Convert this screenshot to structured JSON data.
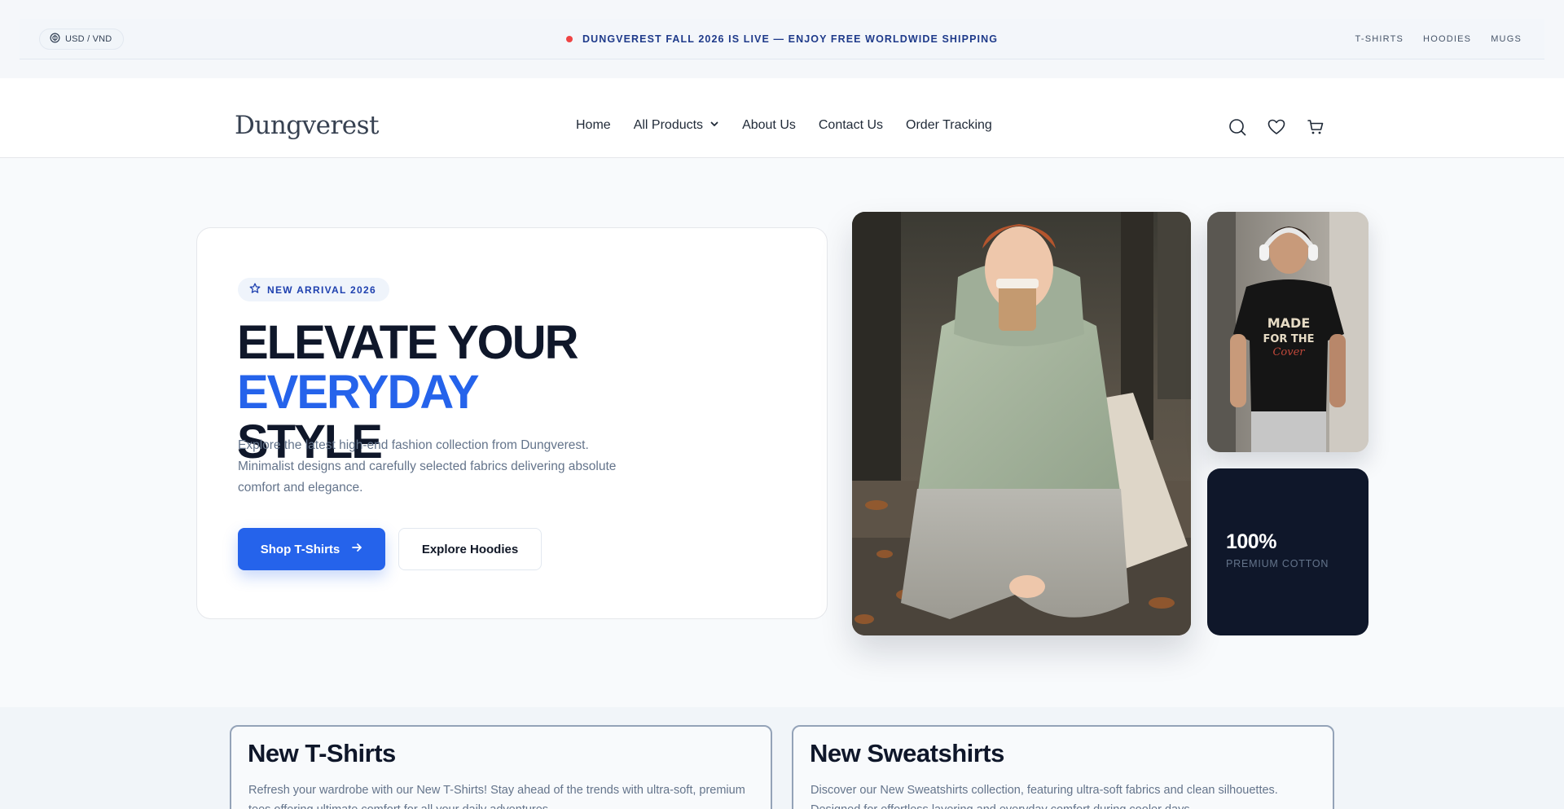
{
  "topbar": {
    "currency": "USD / VND",
    "announcement": "DUNGVEREST FALL 2026 IS LIVE — ENJOY FREE WORLDWIDE SHIPPING",
    "links": [
      "T-SHIRTS",
      "HOODIES",
      "MUGS"
    ]
  },
  "header": {
    "logo": "Dungverest",
    "nav": [
      "Home",
      "All Products",
      "About Us",
      "Contact Us",
      "Order Tracking"
    ],
    "icons": [
      "search-icon",
      "heart-icon",
      "cart-icon"
    ]
  },
  "hero": {
    "badge": "NEW ARRIVAL 2026",
    "title_line1": "ELEVATE YOUR ",
    "title_accent": "EVERYDAY",
    "title_line2": "STYLE",
    "description": "Explore the latest high-end fashion collection from Dungverest. Minimalist designs and carefully selected fabrics delivering absolute comfort and elegance.",
    "primary_button": "Shop T-Shirts",
    "secondary_button": "Explore Hoodies",
    "side_shirt_text_1": "MADE",
    "side_shirt_text_2": "FOR THE",
    "side_shirt_text_3": "Cover",
    "stat_value": "100%",
    "stat_label": "PREMIUM COTTON"
  },
  "categories": [
    {
      "title": "New T-Shirts",
      "description": "Refresh your wardrobe with our New T-Shirts! Stay ahead of the trends with ultra-soft, premium tees offering ultimate comfort for all your daily adventures."
    },
    {
      "title": "New Sweatshirts",
      "description": "Discover our New Sweatshirts collection, featuring ultra-soft fabrics and clean silhouettes. Designed for effortless layering and everyday comfort during cooler days."
    }
  ],
  "colors": {
    "accent": "#2563eb",
    "dark": "#0f172a",
    "muted": "#64748b",
    "alert_dot": "#ef4444"
  }
}
